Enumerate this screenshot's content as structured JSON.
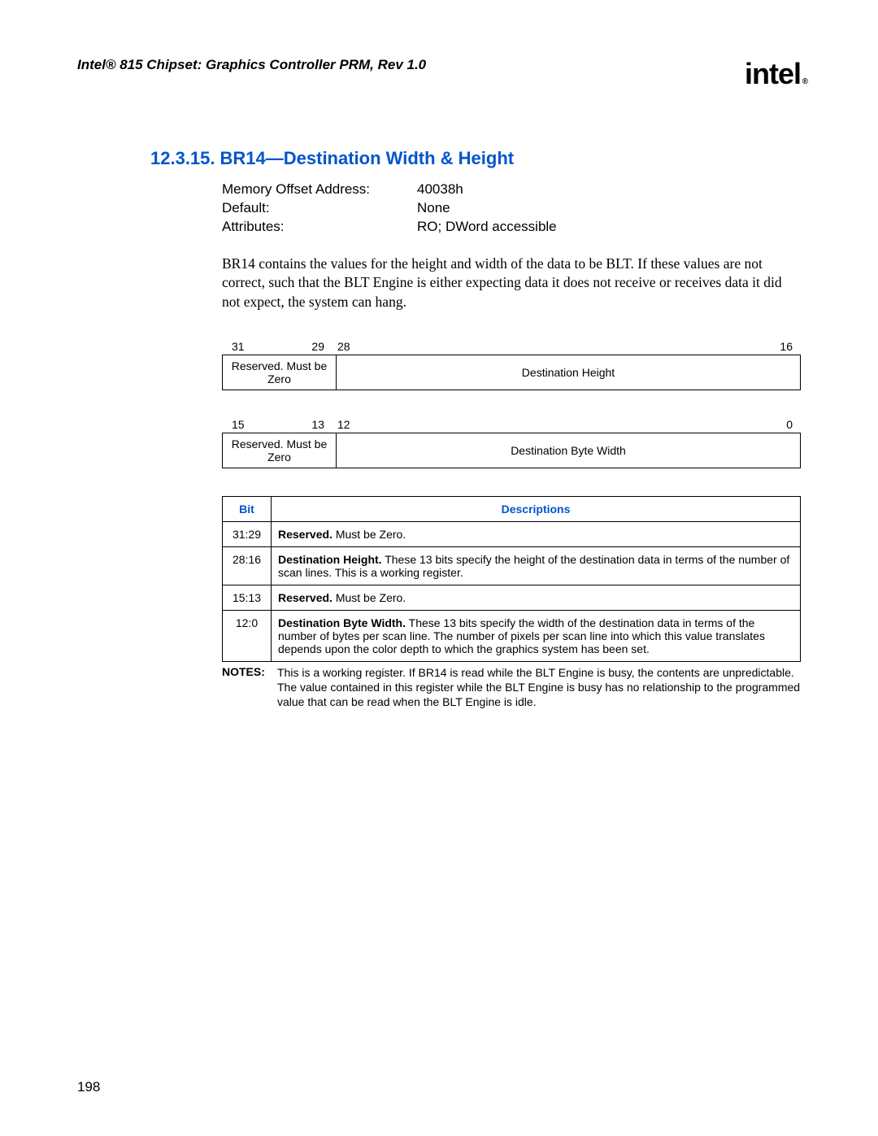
{
  "header": {
    "doc_title": "Intel® 815 Chipset: Graphics Controller PRM, Rev 1.0",
    "logo_text": "intel",
    "logo_sub": "®"
  },
  "section": {
    "number": "12.3.15.",
    "title": "BR14—Destination Width & Height"
  },
  "attributes": [
    {
      "label": "Memory Offset Address:",
      "value": "40038h"
    },
    {
      "label": "Default:",
      "value": "None"
    },
    {
      "label": "Attributes:",
      "value": "RO; DWord accessible"
    }
  ],
  "paragraph": "BR14 contains the values for the height and width of the data to be BLT. If these values are not correct, such that the BLT Engine is either expecting data it does not receive or receives data it did not expect, the system can hang.",
  "bitfields": [
    {
      "labels": {
        "hi_left": "31",
        "hi_right": "29",
        "lo_left": "28",
        "lo_right": "16"
      },
      "reserved": "Reserved. Must be Zero",
      "main": "Destination Height"
    },
    {
      "labels": {
        "hi_left": "15",
        "hi_right": "13",
        "lo_left": "12",
        "lo_right": "0"
      },
      "reserved": "Reserved. Must be Zero",
      "main": "Destination Byte Width"
    }
  ],
  "desc_table": {
    "headers": {
      "bit": "Bit",
      "desc": "Descriptions"
    },
    "rows": [
      {
        "bit": "31:29",
        "bold": "Reserved.",
        "rest": " Must be Zero."
      },
      {
        "bit": "28:16",
        "bold": "Destination Height.",
        "rest": " These 13 bits specify the height of the destination data in terms of the number of scan lines. This is a working register."
      },
      {
        "bit": "15:13",
        "bold": "Reserved.",
        "rest": " Must be Zero."
      },
      {
        "bit": "12:0",
        "bold": "Destination Byte Width.",
        "rest": " These 13 bits specify the width of the destination data in terms of the number of bytes per scan line. The number of pixels per scan line into which this value translates depends upon the color depth to which the graphics system has been set."
      }
    ]
  },
  "notes": {
    "label": "NOTES:",
    "text": "This is a working register. If BR14 is read while the BLT Engine is busy, the contents are unpredictable. The value contained in this register while the BLT Engine is busy has no relationship to the programmed value that can be read when the BLT Engine is idle."
  },
  "page_number": "198"
}
